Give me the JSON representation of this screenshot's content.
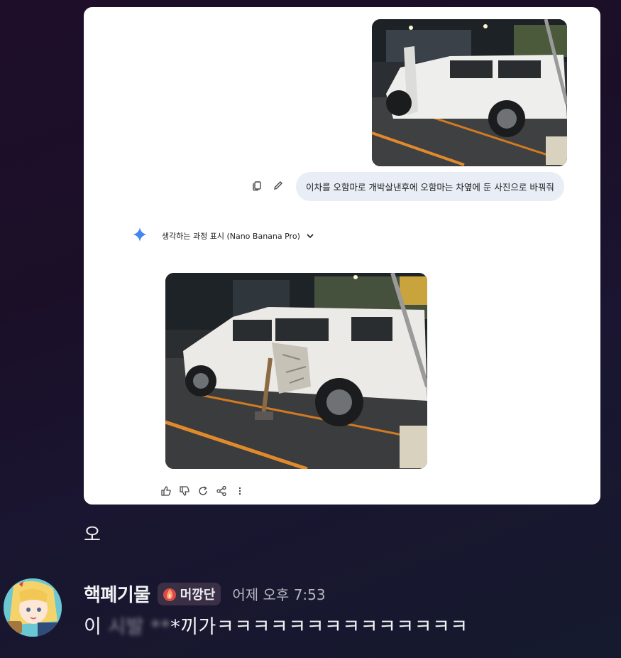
{
  "card": {
    "prompt_text": "이차를 오함마로 개박살낸후에 오함마는 차옆에 둔 사진으로 바꿔줘",
    "thinking_label": "생각하는 과정 표시 (Nano Banana Pro)",
    "icons": {
      "copy": "copy-icon",
      "edit": "pencil-icon",
      "sparkle": "gemini-sparkle-icon",
      "chevron": "chevron-down-icon",
      "like": "thumbs-up-icon",
      "dislike": "thumbs-down-icon",
      "regenerate": "refresh-icon",
      "share": "share-icon",
      "more": "more-vertical-icon"
    }
  },
  "reaction": {
    "text": "오"
  },
  "message": {
    "author": "핵폐기물",
    "tag_label": "머깡단",
    "tag_icon": "fire-icon",
    "timestamp": "어제 오후 7:53",
    "text_start": "이 ",
    "text_blurred": "시발 **",
    "text_end": "*끼가ㅋㅋㅋㅋㅋㅋㅋㅋㅋㅋㅋㅋㅋㅋ"
  },
  "colors": {
    "card_bg": "#ffffff",
    "bubble_bg": "#e9eef6",
    "sparkle": "#4285f4",
    "tag_bg": "#3a2f45"
  }
}
